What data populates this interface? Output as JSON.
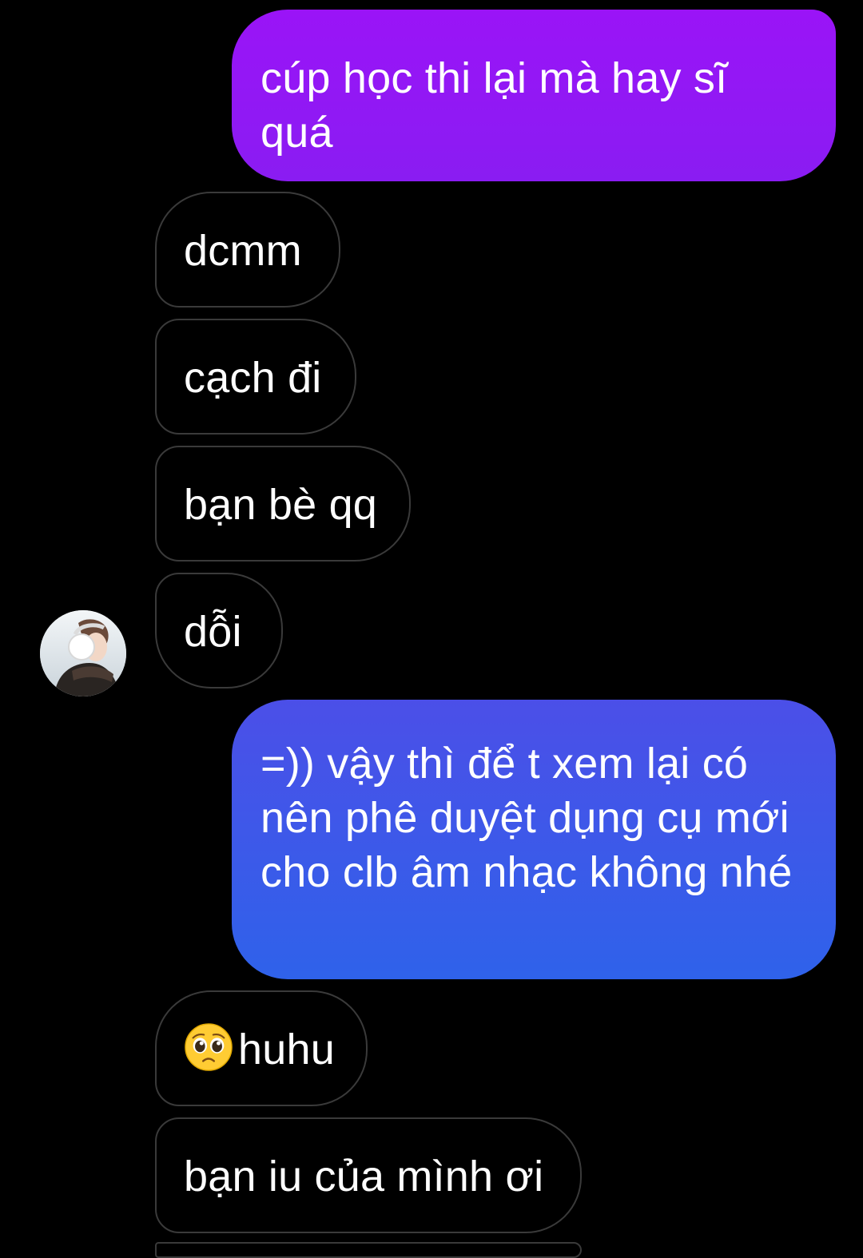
{
  "messages": {
    "sent_1": "cúp học thi lại mà hay sĩ quá",
    "recv_1": "dcmm",
    "recv_2": "cạch đi",
    "recv_3": "bạn bè qq",
    "recv_4": "dỗi",
    "sent_2": "=)) vậy thì để t xem lại có nên phê duyệt dụng cụ mới cho clb âm nhạc không nhé",
    "recv_5_emoji": "pleading-face-emoji",
    "recv_5_text": "huhu",
    "recv_6": "bạn iu của mình ơi"
  },
  "colors": {
    "background": "#000000",
    "sent_bubble_1": "#9a14f7",
    "sent_bubble_2_top": "#4b4fe8",
    "sent_bubble_2_bottom": "#2f62ea",
    "received_bubble_border": "#3a3a3a",
    "text": "#ffffff"
  },
  "contact": {
    "avatar": "contact-avatar-photo"
  }
}
